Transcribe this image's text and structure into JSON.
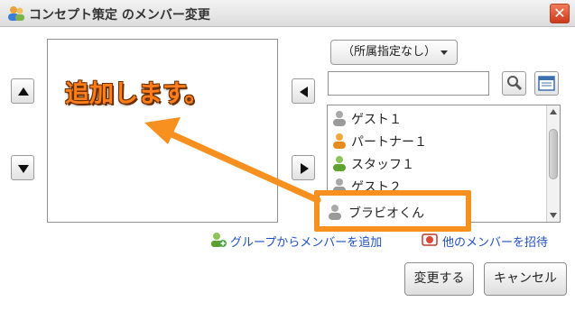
{
  "dialog": {
    "title": "コンセプト策定 のメンバー変更",
    "close_label": "✕"
  },
  "callout": {
    "text": "追加します。"
  },
  "filter": {
    "department_selected": "（所属指定なし）",
    "search_value": "",
    "search_placeholder": ""
  },
  "members": [
    {
      "name": "ゲスト１",
      "icon": "user-gray-icon"
    },
    {
      "name": "パートナー１",
      "icon": "user-orange-icon"
    },
    {
      "name": "スタッフ１",
      "icon": "user-green-icon"
    },
    {
      "name": "ゲスト２",
      "icon": "user-gray-icon"
    }
  ],
  "highlighted_member": {
    "name": "ブラビオくん",
    "icon": "user-gray-icon"
  },
  "links": {
    "add_from_group": "グループからメンバーを追加",
    "invite_others": "他のメンバーを招待"
  },
  "buttons": {
    "submit": "変更する",
    "cancel": "キャンセル"
  },
  "colors": {
    "accent_orange": "#f7901e",
    "link_blue": "#1f4fbf",
    "close_red": "#cc3b1a"
  }
}
